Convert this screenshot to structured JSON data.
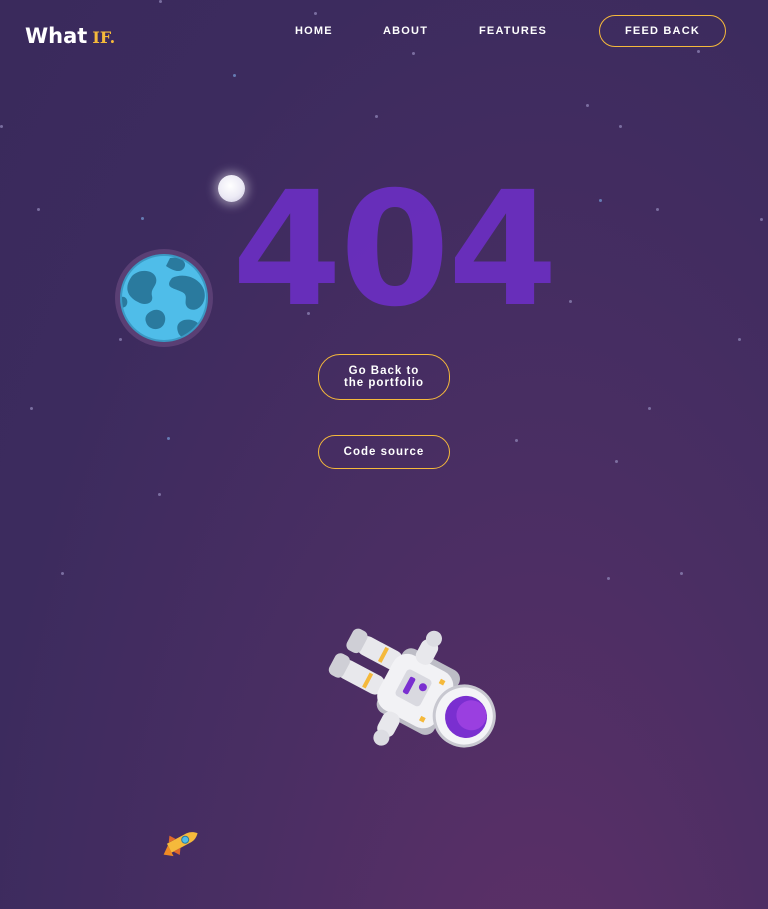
{
  "logo": {
    "main": "What",
    "accent": "IF."
  },
  "nav": {
    "home": "HOME",
    "about": "ABOUT",
    "features": "FEATURES",
    "feedback": "FEED BACK"
  },
  "error": {
    "code": "404"
  },
  "buttons": {
    "back_line1": "Go Back to",
    "back_line2": "the portfolio",
    "code_source": "Code source"
  },
  "colors": {
    "accent": "#f5b93b",
    "error_code": "#6a2fbf",
    "background": "#3c2b5e"
  },
  "icons": [
    "moon-icon",
    "earth-icon",
    "astronaut-illustration",
    "rocket-icon"
  ]
}
